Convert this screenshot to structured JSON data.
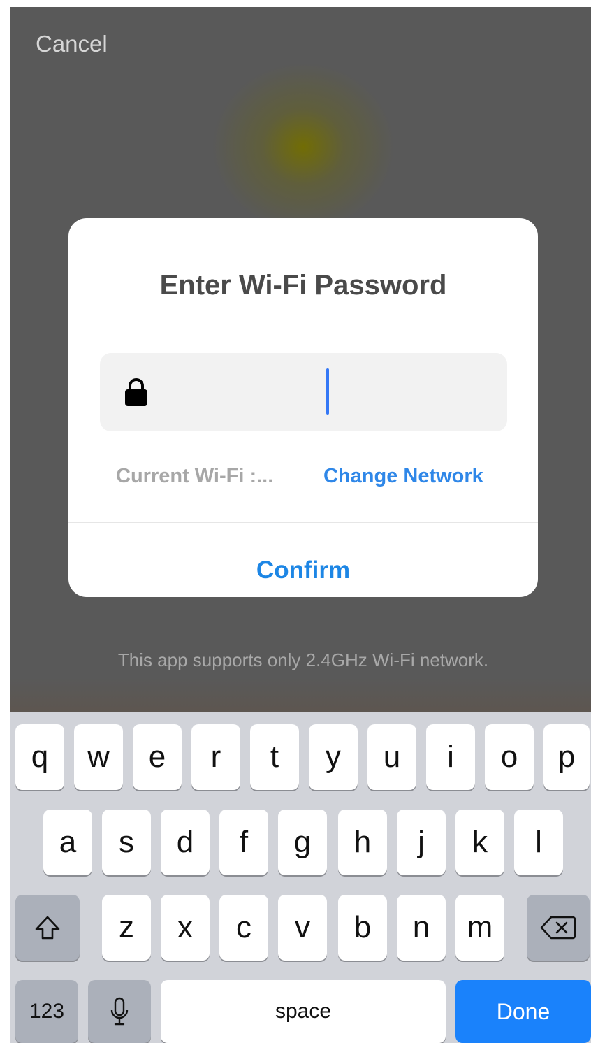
{
  "top_bar": {
    "cancel_label": "Cancel"
  },
  "dialog": {
    "title": "Enter Wi-Fi Password",
    "password_value": "",
    "current_wifi_label": "Current Wi-Fi :...",
    "change_network_label": "Change Network",
    "confirm_label": "Confirm"
  },
  "footer_note": "This app supports only 2.4GHz Wi-Fi network.",
  "keyboard": {
    "row1": [
      "q",
      "w",
      "e",
      "r",
      "t",
      "y",
      "u",
      "i",
      "o",
      "p"
    ],
    "row2": [
      "a",
      "s",
      "d",
      "f",
      "g",
      "h",
      "j",
      "k",
      "l"
    ],
    "row3": [
      "z",
      "x",
      "c",
      "v",
      "b",
      "n",
      "m"
    ],
    "numbers_label": "123",
    "space_label": "space",
    "done_label": "Done"
  },
  "colors": {
    "accent_blue": "#1d86e5",
    "done_key": "#1a82fb",
    "caret": "#3478f6"
  },
  "icons": {
    "lock": "lock-icon",
    "shift": "shift-icon",
    "delete": "delete-icon",
    "microphone": "microphone-icon"
  }
}
